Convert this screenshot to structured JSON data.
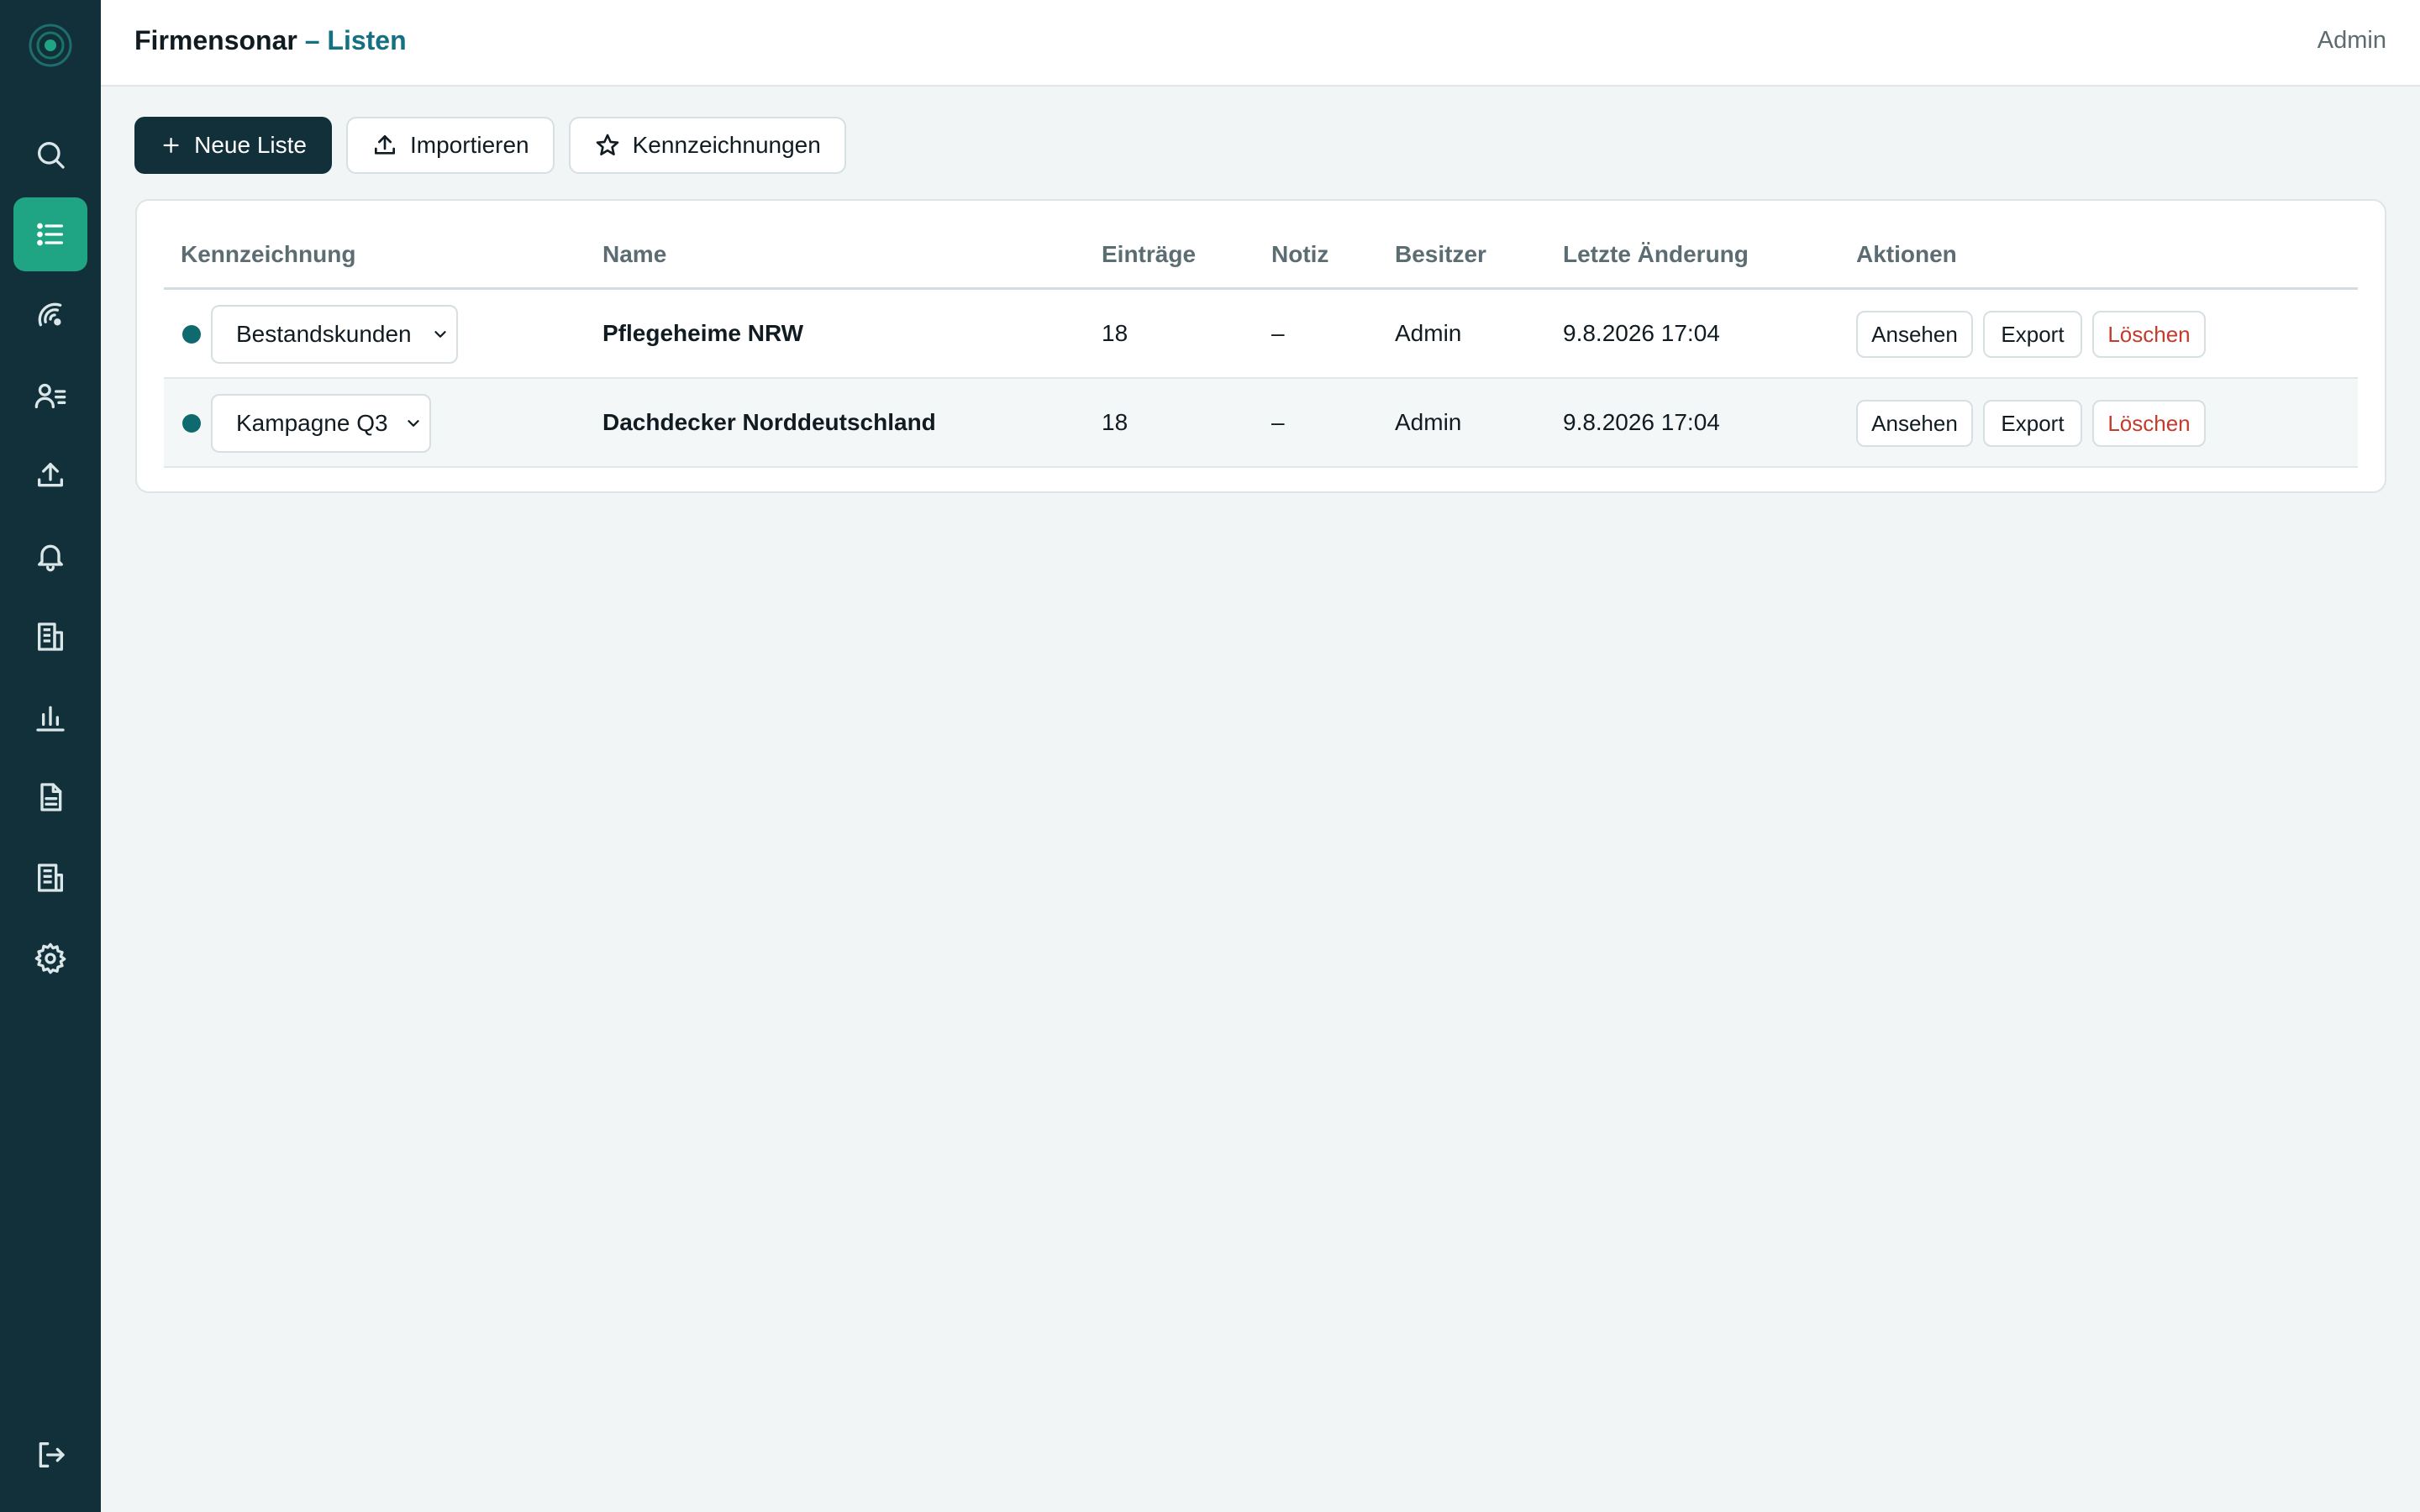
{
  "header": {
    "app_name": "Firmensonar",
    "separator": " – ",
    "section": "Listen",
    "user": "Admin"
  },
  "sidebar": {
    "items": [
      {
        "icon": "search-icon"
      },
      {
        "icon": "list-icon",
        "active": true
      },
      {
        "icon": "radar-icon"
      },
      {
        "icon": "contacts-icon"
      },
      {
        "icon": "upload-icon"
      },
      {
        "icon": "bell-icon"
      },
      {
        "icon": "building-icon"
      },
      {
        "icon": "bar-chart-icon"
      },
      {
        "icon": "document-icon"
      },
      {
        "icon": "company-icon"
      },
      {
        "icon": "gear-icon"
      }
    ],
    "logout_icon": "logout-icon"
  },
  "toolbar": {
    "new_list": "Neue Liste",
    "import": "Importieren",
    "labels": "Kennzeichnungen"
  },
  "table": {
    "headers": {
      "label": "Kennzeichnung",
      "name": "Name",
      "entries": "Einträge",
      "note": "Notiz",
      "owner": "Besitzer",
      "modified": "Letzte Änderung",
      "actions": "Aktionen"
    },
    "rows": [
      {
        "label": "Bestandskunden",
        "name": "Pflegeheime NRW",
        "entries": "18",
        "note": "–",
        "owner": "Admin",
        "modified": "9.8.2026 17:04",
        "view": "Ansehen",
        "export": "Export",
        "delete": "Löschen"
      },
      {
        "label": "Kampagne Q3",
        "name": "Dachdecker Norddeutschland",
        "entries": "18",
        "note": "–",
        "owner": "Admin",
        "modified": "9.8.2026 17:04",
        "view": "Ansehen",
        "export": "Export",
        "delete": "Löschen"
      }
    ]
  },
  "colors": {
    "sidebar": "#11303a",
    "accent": "#1fa584",
    "title_accent": "#147181",
    "danger": "#c53a2c",
    "label_dot": "#0e6a6e"
  }
}
